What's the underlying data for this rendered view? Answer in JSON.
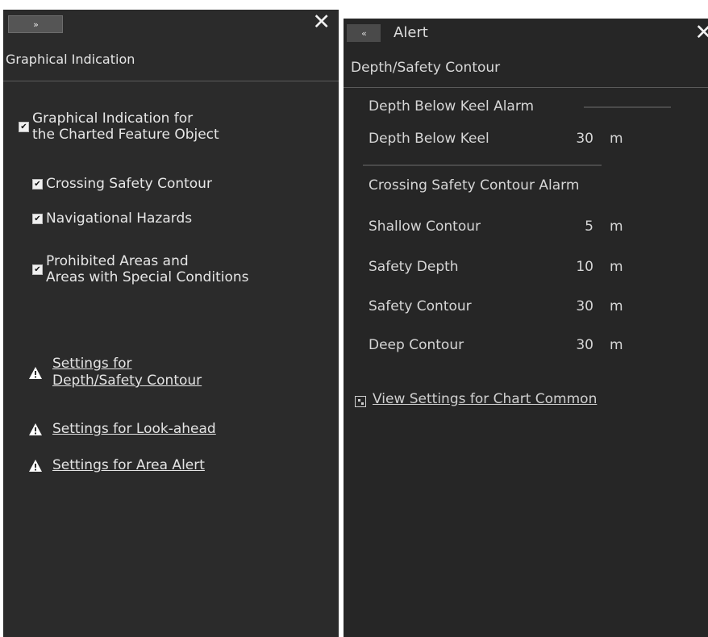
{
  "left_panel": {
    "expand_glyph": "»",
    "close_glyph": "✕",
    "title": "Graphical Indication",
    "main_checkbox": {
      "label": "Graphical Indication for\nthe Charted Feature Object",
      "checked": true
    },
    "sub_checkboxes": [
      {
        "label": "Crossing Safety Contour",
        "checked": true
      },
      {
        "label": "Navigational Hazards",
        "checked": true
      },
      {
        "label": "Prohibited Areas and\nAreas with Special Conditions",
        "checked": true
      }
    ],
    "links": [
      {
        "label": "Settings for\nDepth/Safety Contour",
        "icon": "warning-icon"
      },
      {
        "label": "Settings for Look-ahead",
        "icon": "warning-icon"
      },
      {
        "label": "Settings for Area Alert",
        "icon": "warning-icon"
      }
    ]
  },
  "right_panel": {
    "collapse_glyph": "«",
    "window_title": "Alert",
    "close_glyph": "✕",
    "section_title": "Depth/Safety Contour",
    "depth_below_keel_alarm": "Depth Below Keel Alarm",
    "depth_below_keel": {
      "label": "Depth Below Keel",
      "value": "30",
      "unit": "m"
    },
    "crossing_alarm": "Crossing Safety Contour Alarm",
    "rows": [
      {
        "label": "Shallow Contour",
        "value": "5",
        "unit": "m"
      },
      {
        "label": "Safety Depth",
        "value": "10",
        "unit": "m"
      },
      {
        "label": "Safety Contour",
        "value": "30",
        "unit": "m"
      },
      {
        "label": "Deep Contour",
        "value": "30",
        "unit": "m"
      }
    ],
    "view_settings_link": "View Settings for Chart Common"
  },
  "colors": {
    "panel_bg": "#2b2b2b",
    "text": "#e4e4e4",
    "warning": "#ffffff"
  }
}
